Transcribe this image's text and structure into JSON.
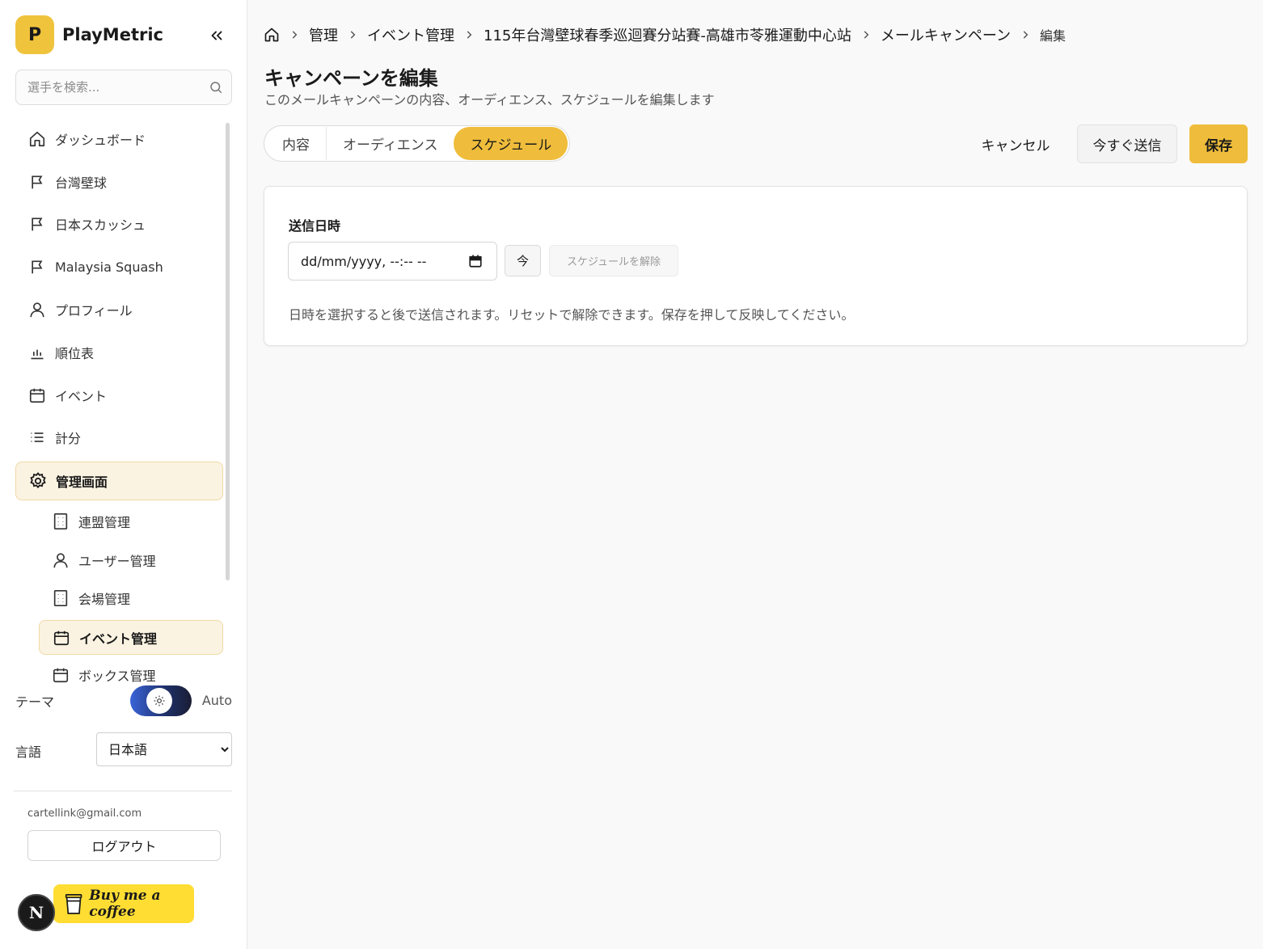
{
  "sidebar": {
    "brand_initial": "P",
    "brand_name": "PlayMetric",
    "search_placeholder": "選手を検索...",
    "items": [
      {
        "label": "ダッシュボード",
        "icon": "home-icon"
      },
      {
        "label": "台灣壁球",
        "icon": "flag-icon"
      },
      {
        "label": "日本スカッシュ",
        "icon": "flag-icon"
      },
      {
        "label": "Malaysia Squash",
        "icon": "flag-icon"
      },
      {
        "label": "プロフィール",
        "icon": "user-icon"
      },
      {
        "label": "順位表",
        "icon": "bar-chart-icon"
      },
      {
        "label": "イベント",
        "icon": "calendar-icon"
      },
      {
        "label": "計分",
        "icon": "list-icon"
      },
      {
        "label": "管理画面",
        "icon": "gear-icon",
        "active": true
      }
    ],
    "sub_items": [
      {
        "label": "連盟管理",
        "icon": "building-icon"
      },
      {
        "label": "ユーザー管理",
        "icon": "user-icon"
      },
      {
        "label": "会場管理",
        "icon": "building-icon"
      },
      {
        "label": "イベント管理",
        "icon": "calendar-icon",
        "active": true
      },
      {
        "label": "ボックス管理",
        "icon": "calendar-icon"
      }
    ],
    "theme_label": "テーマ",
    "theme_mode": "Auto",
    "language_label": "言語",
    "language_selected": "日本語",
    "user_email": "cartellink@gmail.com",
    "logout_label": "ログアウト",
    "next_badge": "N",
    "coffee_label": "Buy me a coffee"
  },
  "breadcrumb": {
    "items": [
      "管理",
      "イベント管理",
      "115年台灣壁球春季巡迴賽分站賽-高雄市苓雅運動中心站",
      "メールキャンペーン"
    ],
    "current": "編集"
  },
  "header": {
    "title": "キャンペーンを編集",
    "subtitle": "このメールキャンペーンの内容、オーディエンス、スケジュールを編集します"
  },
  "tabs": [
    {
      "label": "内容"
    },
    {
      "label": "オーディエンス"
    },
    {
      "label": "スケジュール",
      "active": true
    }
  ],
  "actions": {
    "cancel": "キャンセル",
    "send_now": "今すぐ送信",
    "save": "保存"
  },
  "schedule": {
    "field_label": "送信日時",
    "datetime_value": "dd/mm/yyyy, --:-- --",
    "now_button": "今",
    "clear_button": "スケジュールを解除",
    "help_text": "日時を選択すると後で送信されます。リセットで解除できます。保存を押して反映してください。"
  },
  "colors": {
    "accent": "#efbd3b",
    "active_bg": "#fbf3e2",
    "coffee_yellow": "#ffdd33"
  }
}
